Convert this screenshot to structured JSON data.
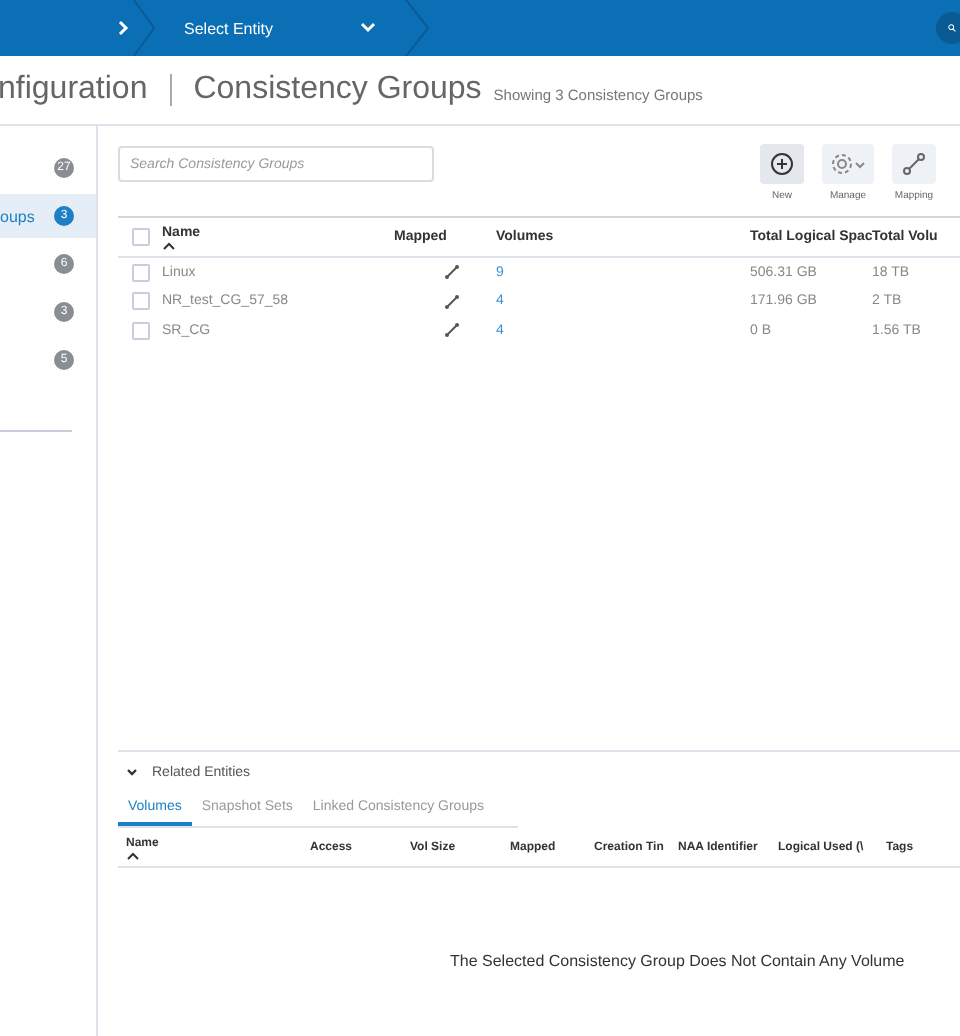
{
  "top_bar": {
    "breadcrumb": {
      "label": "Select Entity"
    }
  },
  "header": {
    "section": "nfiguration",
    "title": "Consistency Groups",
    "subtitle": "Showing 3 Consistency Groups"
  },
  "sidebar": {
    "items": [
      {
        "badge": "27",
        "selected": false
      },
      {
        "label": "oups",
        "badge": "3",
        "selected": true
      },
      {
        "badge": "6",
        "selected": false
      },
      {
        "badge": "3",
        "selected": false
      },
      {
        "badge": "5",
        "selected": false
      }
    ]
  },
  "search": {
    "placeholder": "Search Consistency Groups"
  },
  "toolbar": [
    {
      "kind": "new",
      "label": "New"
    },
    {
      "kind": "manage",
      "label": "Manage"
    },
    {
      "kind": "mapping",
      "label": "Mapping"
    }
  ],
  "table": {
    "select_all_checked": false,
    "columns": [
      {
        "label": "Name",
        "sorted": true
      },
      {
        "label": "Mapped",
        "sorted": false
      },
      {
        "label": "Volumes",
        "sorted": false
      },
      {
        "label": "Total Logical Spac",
        "sorted": false
      },
      {
        "label": "Total Volu",
        "sorted": false
      }
    ],
    "rows": [
      {
        "checked": false,
        "name": "Linux",
        "mapped": true,
        "volumes": "9",
        "logical": "506.31 GB",
        "total": "18 TB"
      },
      {
        "checked": false,
        "name": "NR_test_CG_57_58",
        "mapped": true,
        "volumes": "4",
        "logical": "171.96 GB",
        "total": "2 TB"
      },
      {
        "checked": false,
        "name": "SR_CG",
        "mapped": true,
        "volumes": "4",
        "logical": "0 B",
        "total": "1.56 TB"
      }
    ]
  },
  "related": {
    "title": "Related Entities",
    "expanded": true,
    "tabs": [
      {
        "label": "Volumes",
        "selected": true
      },
      {
        "label": "Snapshot Sets",
        "selected": false
      },
      {
        "label": "Linked Consistency Groups",
        "selected": false
      }
    ],
    "columns": [
      {
        "label": "Name",
        "sorted": true
      },
      {
        "label": "Access",
        "sorted": false
      },
      {
        "label": "Vol Size",
        "sorted": false
      },
      {
        "label": "Mapped",
        "sorted": false
      },
      {
        "label": "Creation Tin",
        "sorted": false
      },
      {
        "label": "NAA Identifier",
        "sorted": false
      },
      {
        "label": "Logical Used (\\",
        "sorted": false
      },
      {
        "label": "Tags",
        "sorted": false
      }
    ],
    "empty_message": "The Selected Consistency Group Does Not Contain Any Volume"
  }
}
